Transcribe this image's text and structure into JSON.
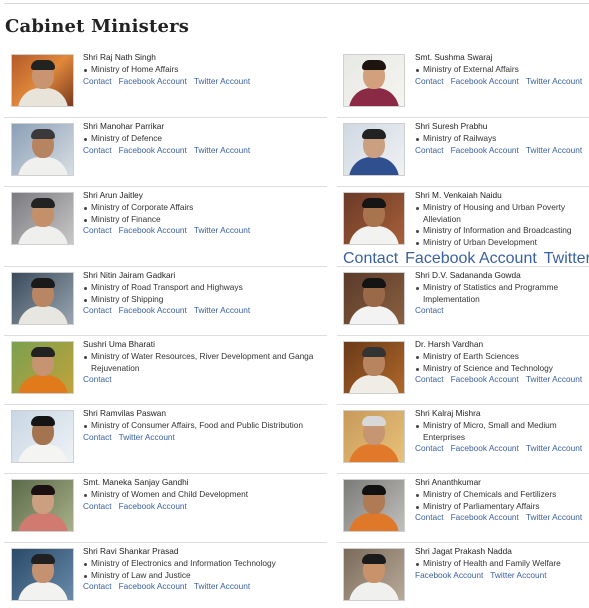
{
  "page": {
    "title": "Cabinet Ministers"
  },
  "ministers": [
    {
      "name": "Shri Raj Nath Singh",
      "ministries": [
        "Ministry of Home Affairs"
      ],
      "links": [
        "Contact",
        "Facebook Account",
        "Twitter Account"
      ]
    },
    {
      "name": "Smt. Sushma Swaraj",
      "ministries": [
        "Ministry of External Affairs"
      ],
      "links": [
        "Contact",
        "Facebook Account",
        "Twitter Account"
      ]
    },
    {
      "name": "Shri Manohar Parrikar",
      "ministries": [
        "Ministry of Defence"
      ],
      "links": [
        "Contact",
        "Facebook Account",
        "Twitter Account"
      ]
    },
    {
      "name": "Shri Suresh Prabhu",
      "ministries": [
        "Ministry of Railways"
      ],
      "links": [
        "Contact",
        "Facebook Account",
        "Twitter Account"
      ]
    },
    {
      "name": "Shri Arun Jaitley",
      "ministries": [
        "Ministry of Corporate Affairs",
        "Ministry of Finance"
      ],
      "links": [
        "Contact",
        "Facebook Account",
        "Twitter Account"
      ]
    },
    {
      "name": "Shri M. Venkaiah Naidu",
      "ministries": [
        "Ministry of Housing and Urban Poverty Alleviation",
        "Ministry of Information and Broadcasting",
        "Ministry of Urban Development"
      ],
      "links": [
        "Contact",
        "Facebook Account",
        "Twitter Account"
      ]
    },
    {
      "name": "Shri Nitin Jairam Gadkari",
      "ministries": [
        "Ministry of Road Transport and Highways",
        "Ministry of Shipping"
      ],
      "links": [
        "Contact",
        "Facebook Account",
        "Twitter Account"
      ]
    },
    {
      "name": "Shri D.V. Sadananda Gowda",
      "ministries": [
        "Ministry of Statistics and Programme Implementation"
      ],
      "links": [
        "Contact"
      ]
    },
    {
      "name": "Sushri Uma Bharati",
      "ministries": [
        "Ministry of Water Resources, River Development and Ganga Rejuvenation"
      ],
      "links": [
        "Contact"
      ]
    },
    {
      "name": "Dr. Harsh Vardhan",
      "ministries": [
        "Ministry of Earth Sciences",
        "Ministry of Science and Technology"
      ],
      "links": [
        "Contact",
        "Facebook Account",
        "Twitter Account"
      ]
    },
    {
      "name": "Shri Ramvilas Paswan",
      "ministries": [
        "Ministry of Consumer Affairs, Food and Public Distribution"
      ],
      "links": [
        "Contact",
        "Twitter Account"
      ]
    },
    {
      "name": "Shri Kalraj Mishra",
      "ministries": [
        "Ministry of Micro, Small and Medium Enterprises"
      ],
      "links": [
        "Contact",
        "Facebook Account",
        "Twitter Account"
      ]
    },
    {
      "name": "Smt. Maneka Sanjay Gandhi",
      "ministries": [
        "Ministry of Women and Child Development"
      ],
      "links": [
        "Contact",
        "Facebook Account"
      ]
    },
    {
      "name": "Shri Ananthkumar",
      "ministries": [
        "Ministry of Chemicals and Fertilizers",
        "Ministry of Parliamentary Affairs"
      ],
      "links": [
        "Contact",
        "Facebook Account",
        "Twitter Account"
      ]
    },
    {
      "name": "Shri Ravi Shankar Prasad",
      "ministries": [
        "Ministry of Electronics and Information Technology",
        "Ministry of Law and Justice"
      ],
      "links": [
        "Contact",
        "Facebook Account",
        "Twitter Account"
      ]
    },
    {
      "name": "Shri Jagat Prakash Nadda",
      "ministries": [
        "Ministry of Health and Family Welfare"
      ],
      "links": [
        "Facebook Account",
        "Twitter Account"
      ]
    }
  ]
}
